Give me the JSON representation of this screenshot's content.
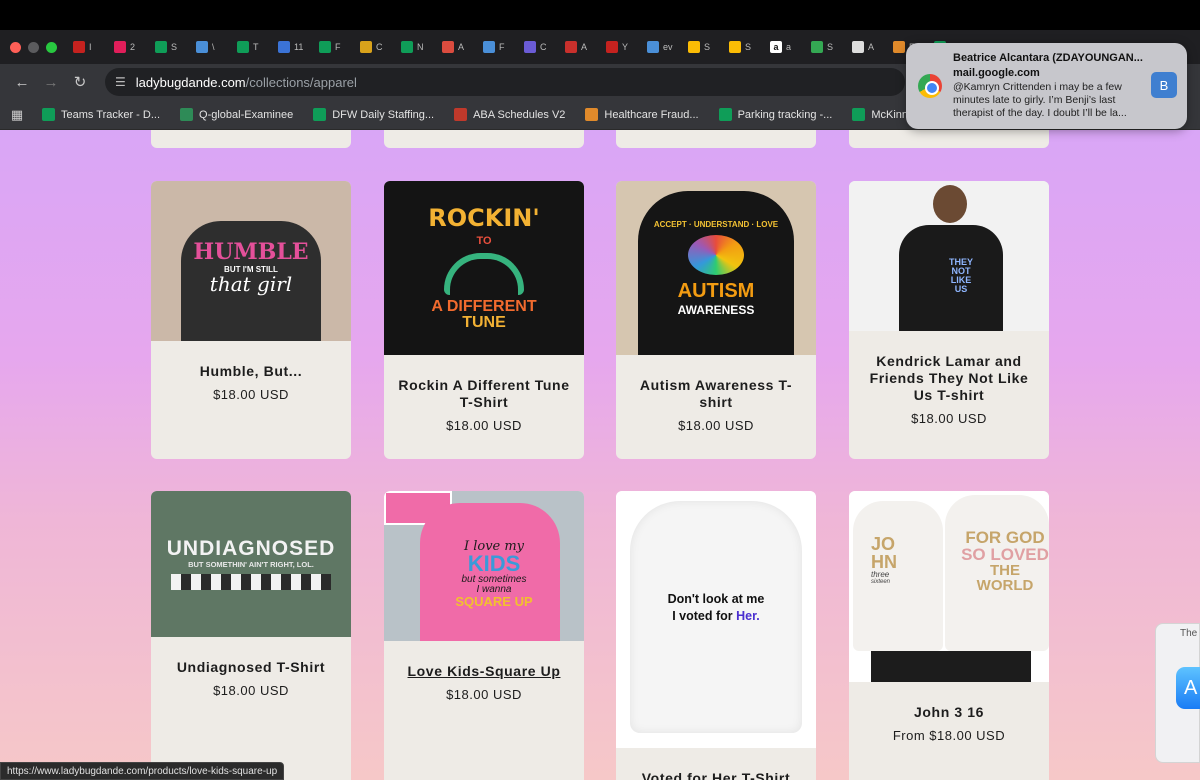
{
  "browser": {
    "tabs": [
      {
        "icon": "gmail-icon",
        "label": "I",
        "color": "#c5221f"
      },
      {
        "icon": "slack-icon",
        "label": "2",
        "color": "#e01e5a"
      },
      {
        "icon": "sheets-icon",
        "label": "S",
        "color": "#0f9d58"
      },
      {
        "icon": "cloud-icon",
        "label": "\\",
        "color": "#4a8fd8"
      },
      {
        "icon": "sheets-icon",
        "label": "T",
        "color": "#0f9d58"
      },
      {
        "icon": "calendar-icon",
        "label": "11",
        "color": "#3b73d6"
      },
      {
        "icon": "sheets-icon",
        "label": "F",
        "color": "#0f9d58"
      },
      {
        "icon": "grid-icon",
        "label": "C",
        "color": "#d9a21b"
      },
      {
        "icon": "sheets-icon",
        "label": "N",
        "color": "#0f9d58"
      },
      {
        "icon": "todoist-icon",
        "label": "A",
        "color": "#db4c3f"
      },
      {
        "icon": "cloud-icon",
        "label": "F",
        "color": "#4a8fd8"
      },
      {
        "icon": "edit-icon",
        "label": "C",
        "color": "#6b5cd6"
      },
      {
        "icon": "acrobat-icon",
        "label": "A",
        "color": "#c9302c"
      },
      {
        "icon": "gmail-icon",
        "label": "Y",
        "color": "#c5221f"
      },
      {
        "icon": "ev-icon",
        "label": "ev",
        "color": "#4a8fd8"
      },
      {
        "icon": "drive-icon",
        "label": "S",
        "color": "#fbbc05"
      },
      {
        "icon": "drive-icon",
        "label": "S",
        "color": "#fbbc05"
      },
      {
        "icon": "amazon-icon",
        "label": "a",
        "color": "#ffffff"
      },
      {
        "icon": "a-icon",
        "label": "S",
        "color": "#34a853"
      },
      {
        "icon": "page-icon",
        "label": "A",
        "color": "#dddddd"
      },
      {
        "icon": "plane-icon",
        "label": "F",
        "color": "#e08a2b"
      },
      {
        "icon": "sheets-icon",
        "label": "",
        "color": "#0f9d58"
      }
    ],
    "url_host": "ladybugdande.com",
    "url_path": "/collections/apparel",
    "bookmarks": [
      {
        "icon": "sheets-icon",
        "label": "Teams Tracker - D...",
        "color": "#0f9d58"
      },
      {
        "icon": "globe-icon",
        "label": "Q-global-Examinee",
        "color": "#2e8b57"
      },
      {
        "icon": "sheets-icon",
        "label": "DFW Daily Staffing...",
        "color": "#0f9d58"
      },
      {
        "icon": "schedule-icon",
        "label": "ABA Schedules V2",
        "color": "#c0392b"
      },
      {
        "icon": "caret-icon",
        "label": "Healthcare Fraud...",
        "color": "#e08a2b"
      },
      {
        "icon": "sheets-icon",
        "label": "Parking tracking -...",
        "color": "#0f9d58"
      },
      {
        "icon": "sheets-icon",
        "label": "McKinney Budget....",
        "color": "#0f9d58"
      }
    ],
    "status_url": "https://www.ladybugdande.com/products/love-kids-square-up"
  },
  "notification": {
    "title": "Beatrice Alcantara (ZDAYOUNGAN...",
    "source": "mail.google.com",
    "body": "@Kamryn Crittenden i may be a few minutes late to girly. I’m Benji’s last therapist of the day. I doubt I’ll be la...",
    "avatar_letter": "B"
  },
  "side_popup": {
    "text": "The"
  },
  "products": [
    {
      "name": "Humble, But...",
      "price": "$18.00 USD",
      "art": [
        "HUMBLE",
        "BUT I'M STILL",
        "that girl"
      ],
      "shirt_color": "#2e2e2e",
      "bg": "#cbb8a8"
    },
    {
      "name": "Rockin A Different Tune T-Shirt",
      "price": "$18.00 USD",
      "art": [
        "ROCKIN'",
        "TO",
        "A DIFFERENT",
        "TUNE"
      ],
      "shirt_color": "#141414",
      "bg": "#141414"
    },
    {
      "name": "Autism Awareness T-shirt",
      "price": "$18.00 USD",
      "art": [
        "ACCEPT · UNDERSTAND · LOVE",
        "AUTISM",
        "AWARENESS"
      ],
      "shirt_color": "#151515",
      "bg": "#d6c6b0"
    },
    {
      "name": "Kendrick Lamar and Friends They Not Like Us T-shirt",
      "price": "$18.00 USD",
      "art": [
        "THEY",
        "NOT",
        "LIKE",
        "US"
      ],
      "shirt_color": "#1a1a1a",
      "bg": "#f2f2f2"
    },
    {
      "name": "Undiagnosed T-Shirt",
      "price": "$18.00 USD",
      "art": [
        "UNDIAGNOSED",
        "BUT SOMETHIN' AIN'T RIGHT, LOL."
      ],
      "shirt_color": "#5f7764",
      "bg": "#5f7764"
    },
    {
      "name": "Love Kids-Square Up",
      "price": "$18.00 USD",
      "art": [
        "I love my",
        "KIDS",
        "but sometimes",
        "I wanna",
        "SQUARE UP"
      ],
      "shirt_color": "#f06ba8",
      "bg": "#b9c2c8"
    },
    {
      "name": "Voted for Her T-Shirt",
      "price": "",
      "art": [
        "Don't look at me",
        "I voted for",
        "Her."
      ],
      "shirt_color": "#f7f7f7",
      "bg": "#ffffff"
    },
    {
      "name": "John 3 16",
      "price": "From $18.00 USD",
      "art": [
        "JO",
        "HN",
        "three",
        "sixteen",
        "FOR GOD",
        "SO LOVED",
        "THE WORLD"
      ],
      "shirt_color": "#f3f1ee",
      "bg": "#ffffff"
    }
  ]
}
